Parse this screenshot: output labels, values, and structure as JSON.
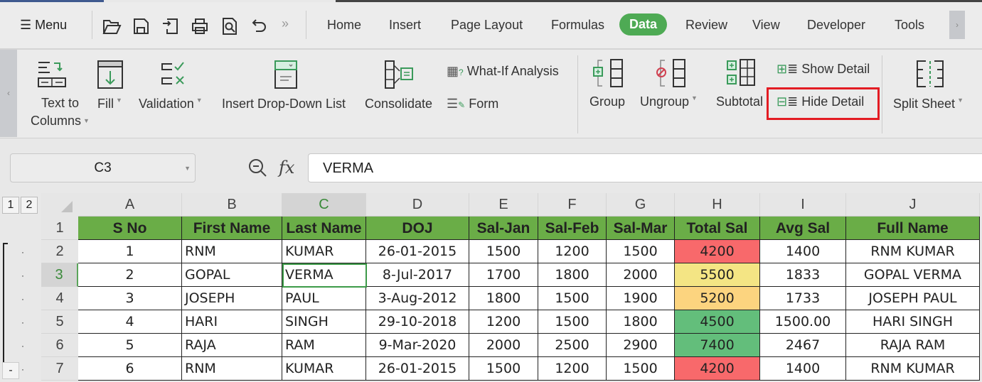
{
  "menu": {
    "label": "Menu"
  },
  "tabs": [
    "Home",
    "Insert",
    "Page Layout",
    "Formulas",
    "Data",
    "Review",
    "View",
    "Developer",
    "Tools"
  ],
  "active_tab": "Data",
  "ribbon": {
    "text_to_columns": [
      "Text to",
      "Columns"
    ],
    "fill": "Fill",
    "validation": "Validation",
    "insert_dropdown": "Insert Drop-Down List",
    "consolidate": "Consolidate",
    "what_if": "What-If Analysis",
    "form": "Form",
    "group": "Group",
    "ungroup": "Ungroup",
    "subtotal": "Subtotal",
    "show_detail": "Show Detail",
    "hide_detail": "Hide Detail",
    "split_sheet": "Split Sheet"
  },
  "namebox": "C3",
  "formula": {
    "fx": "fx",
    "value": "VERMA"
  },
  "outline_levels": [
    "1",
    "2"
  ],
  "outline_collapse": "-",
  "columns": [
    "A",
    "B",
    "C",
    "D",
    "E",
    "F",
    "G",
    "H",
    "I",
    "J"
  ],
  "headers": [
    "S No",
    "First Name",
    "Last Name",
    "DOJ",
    "Sal-Jan",
    "Sal-Feb",
    "Sal-Mar",
    "Total Sal",
    "Avg Sal",
    "Full Name"
  ],
  "rows": [
    [
      "1",
      "RNM",
      "KUMAR",
      "26-01-2015",
      "1500",
      "1200",
      "1500",
      "4200",
      "1400",
      "RNM KUMAR"
    ],
    [
      "2",
      "GOPAL",
      "VERMA",
      "8-Jul-2017",
      "1700",
      "1800",
      "2000",
      "5500",
      "1833",
      "GOPAL  VERMA"
    ],
    [
      "3",
      "JOSEPH",
      "PAUL",
      "3-Aug-2012",
      "1800",
      "1500",
      "1900",
      "5200",
      "1733",
      "JOSEPH  PAUL"
    ],
    [
      "4",
      "HARI",
      "SINGH",
      "29-10-2018",
      "1200",
      "1500",
      "1800",
      "4500",
      "1500.00",
      "HARI  SINGH"
    ],
    [
      "5",
      "RAJA",
      "RAM",
      "9-Mar-2020",
      "2000",
      "2500",
      "2900",
      "7400",
      "2467",
      "RAJA  RAM"
    ],
    [
      "6",
      "RNM",
      "KUMAR",
      "26-01-2015",
      "1500",
      "1200",
      "1500",
      "4200",
      "1400",
      "RNM KUMAR"
    ]
  ],
  "total_colors": [
    "#f8696b",
    "#f4e584",
    "#fcd47f",
    "#63be7b",
    "#63be7b",
    "#f8696b"
  ],
  "colors": {
    "header_green": "#6aad47",
    "accent": "#4eaa54",
    "highlight": "#e31c23"
  }
}
